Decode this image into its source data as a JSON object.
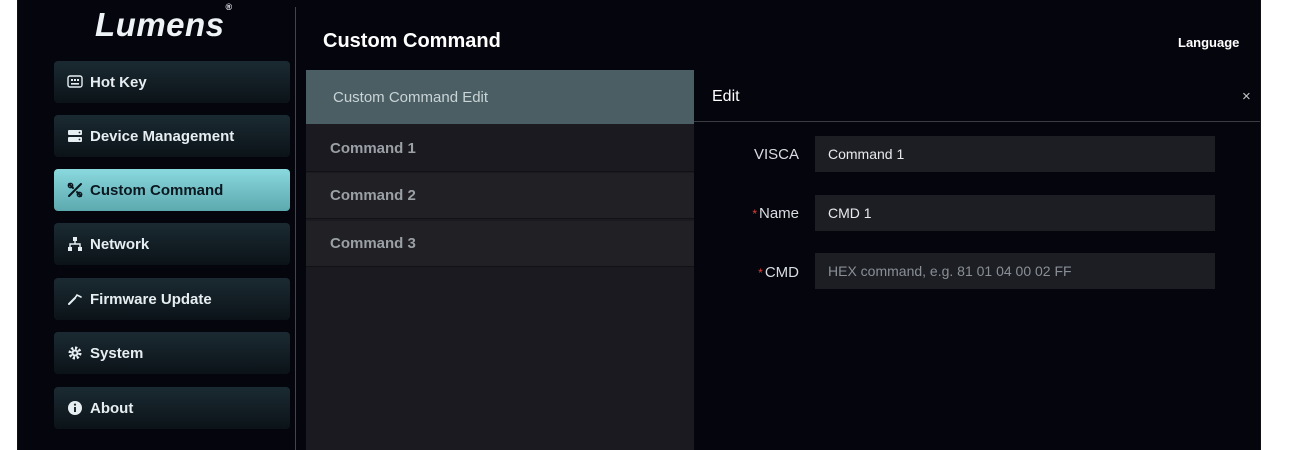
{
  "app": {
    "logo": "Lumens",
    "logo_mark": "®"
  },
  "sidebar": {
    "items": [
      {
        "label": "Hot Key",
        "icon": "keyboard-icon"
      },
      {
        "label": "Device Management",
        "icon": "server-icon"
      },
      {
        "label": "Custom Command",
        "icon": "tools-icon",
        "active": true
      },
      {
        "label": "Network",
        "icon": "network-icon"
      },
      {
        "label": "Firmware Update",
        "icon": "wrench-icon"
      },
      {
        "label": "System",
        "icon": "gear-icon"
      },
      {
        "label": "About",
        "icon": "info-icon"
      }
    ]
  },
  "header": {
    "title": "Custom Command",
    "language": "Language"
  },
  "list": {
    "header": "Custom Command Edit",
    "commands": [
      "Command 1",
      "Command 2",
      "Command 3"
    ]
  },
  "edit": {
    "title": "Edit",
    "close": "×",
    "required_mark": "*",
    "visca_label": "VISCA",
    "visca_value": "Command 1",
    "name_label": "Name",
    "name_value": "CMD 1",
    "cmd_label": "CMD",
    "cmd_placeholder": "HEX command, e.g. 81 01 04 00 02 FF"
  },
  "colors": {
    "background": "#05050d",
    "accent": "#8ad9df",
    "required": "#e0413a"
  }
}
